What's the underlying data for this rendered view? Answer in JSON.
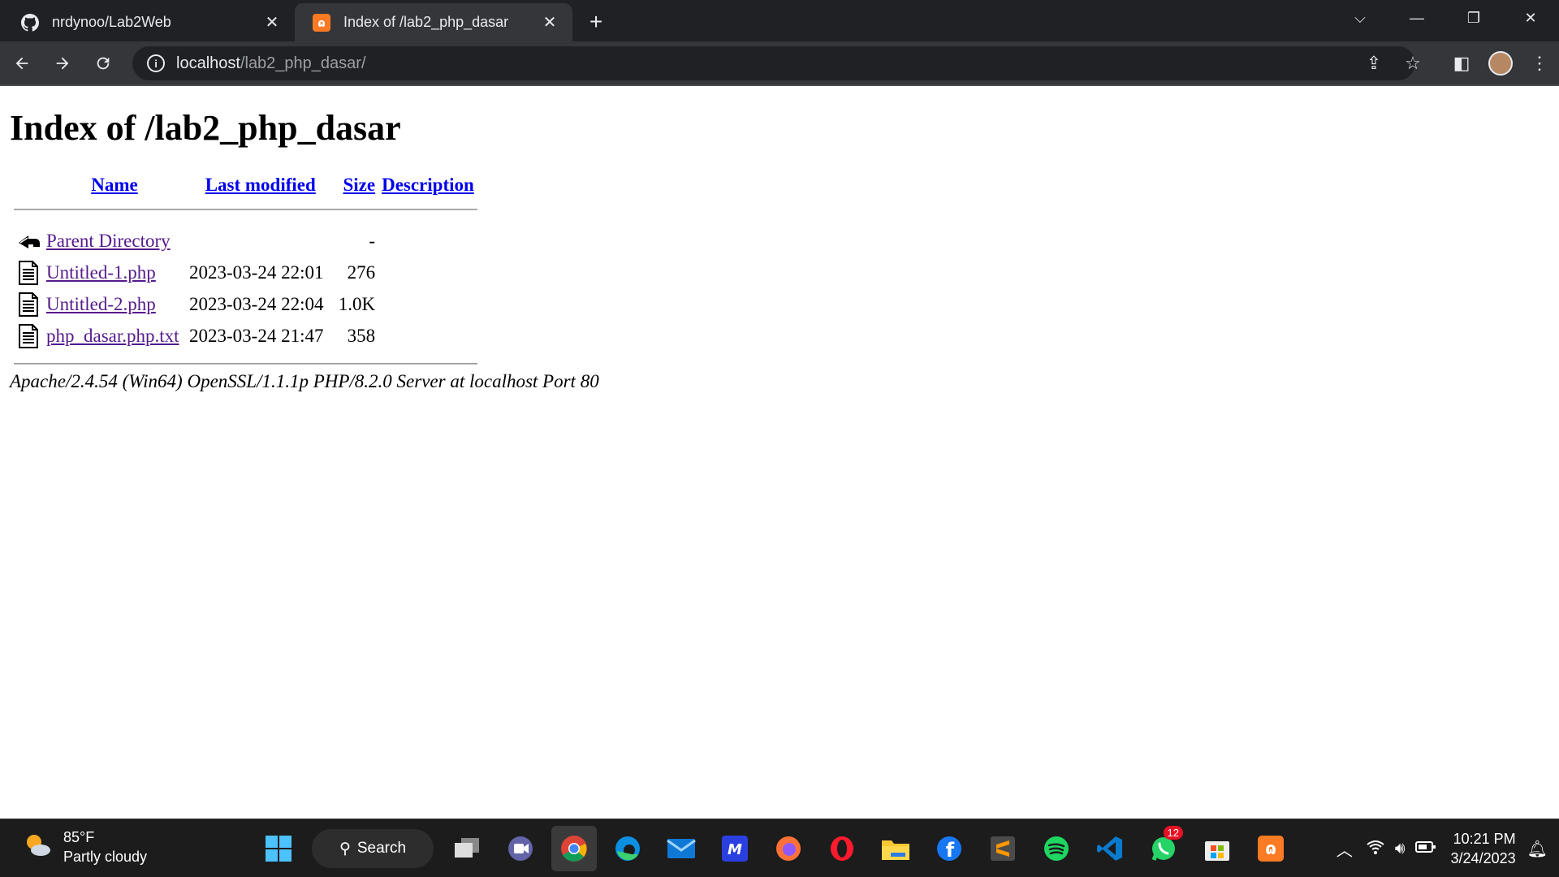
{
  "browser": {
    "tabs": [
      {
        "title": "nrdynoo/Lab2Web",
        "icon": "github-icon",
        "active": false
      },
      {
        "title": "Index of /lab2_php_dasar",
        "icon": "xampp-icon",
        "active": true
      }
    ],
    "address": {
      "host": "localhost",
      "path": "/lab2_php_dasar/"
    }
  },
  "page": {
    "heading": "Index of /lab2_php_dasar",
    "columns": {
      "name": "Name",
      "last_modified": "Last modified",
      "size": "Size",
      "description": "Description"
    },
    "entries": [
      {
        "name": "Parent Directory",
        "modified": "",
        "size": "-",
        "icon": "back-icon"
      },
      {
        "name": "Untitled-1.php",
        "modified": "2023-03-24 22:01",
        "size": "276",
        "icon": "file-icon"
      },
      {
        "name": "Untitled-2.php",
        "modified": "2023-03-24 22:04",
        "size": "1.0K",
        "icon": "file-icon"
      },
      {
        "name": "php_dasar.php.txt",
        "modified": "2023-03-24 21:47",
        "size": "358",
        "icon": "file-icon"
      }
    ],
    "address": "Apache/2.4.54 (Win64) OpenSSL/1.1.1p PHP/8.2.0 Server at localhost Port 80"
  },
  "taskbar": {
    "weather": {
      "temp": "85°F",
      "condition": "Partly cloudy"
    },
    "search_label": "Search",
    "whatsapp_badge": "12",
    "clock": {
      "time": "10:21 PM",
      "date": "3/24/2023"
    }
  },
  "colors": {
    "tabbar": "#202124",
    "toolbar": "#35363a",
    "link": "#0000ee",
    "visited": "#551a8b"
  }
}
